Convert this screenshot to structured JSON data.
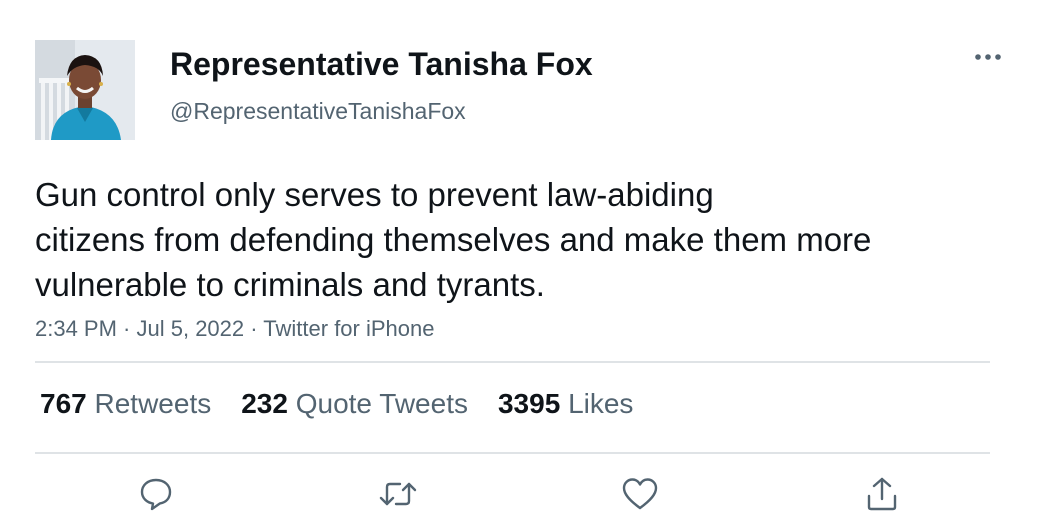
{
  "author": {
    "display_name": "Representative Tanisha Fox",
    "handle": "@RepresentativeTanishaFox",
    "avatar_icon": "profile-photo"
  },
  "tweet": {
    "text_lines": [
      "Gun control only serves to prevent law-abiding",
      "citizens from defending themselves and make them more",
      "vulnerable to criminals and tyrants."
    ],
    "time": "2:34 PM",
    "date": "Jul 5, 2022",
    "source": "Twitter for iPhone",
    "separator": " · "
  },
  "stats": {
    "retweets": {
      "count": "767",
      "label": "Retweets"
    },
    "quotes": {
      "count": "232",
      "label": "Quote Tweets"
    },
    "likes": {
      "count": "3395",
      "label": "Likes"
    }
  },
  "actions": {
    "reply_icon": "reply-icon",
    "retweet_icon": "retweet-icon",
    "like_icon": "heart-icon",
    "share_icon": "share-icon"
  },
  "colors": {
    "text_primary": "#0f1419",
    "text_secondary": "#536471",
    "divider": "#dfe3e6",
    "icon": "#536471"
  }
}
